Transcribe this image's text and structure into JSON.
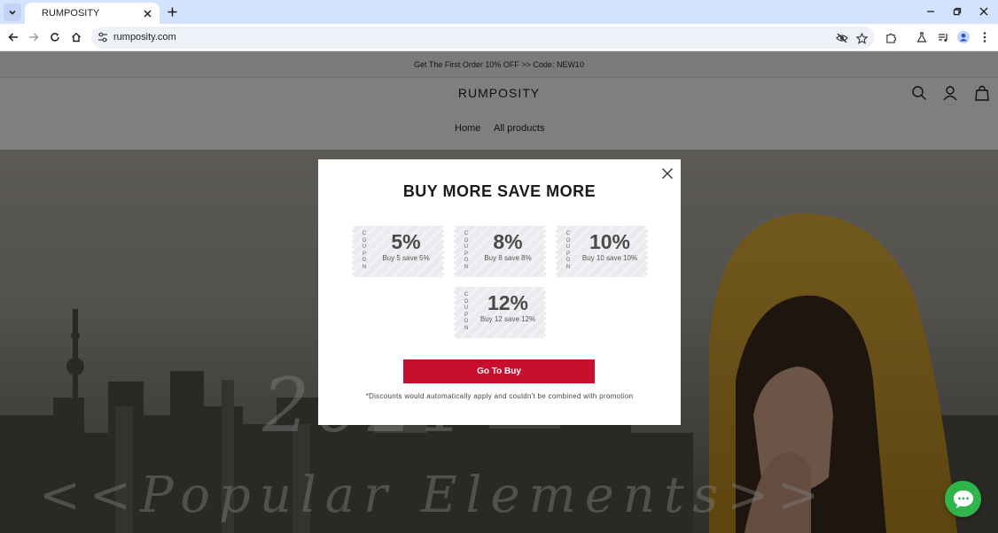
{
  "browser": {
    "tab_title": "RUMPOSITY",
    "url": "rumposity.com"
  },
  "icons": {
    "tab_list": "chevron-down-icon",
    "tab_close": "close-icon",
    "new_tab": "plus-icon",
    "minimize": "minimize-icon",
    "restore": "restore-icon",
    "close_window": "close-icon",
    "back": "arrow-left-icon",
    "forward": "arrow-right-icon",
    "reload": "reload-icon",
    "home": "home-icon",
    "site_info": "tune-icon",
    "eye_off": "eye-off-icon",
    "bookmark": "star-icon",
    "extensions": "puzzle-icon",
    "labs": "flask-icon",
    "media": "media-queue-icon",
    "profile": "person-icon",
    "menu": "more-vertical-icon",
    "search": "search-icon",
    "account": "user-icon",
    "cart": "bag-icon",
    "modal_close": "close-icon",
    "chat": "chat-bubble-icon"
  },
  "colors": {
    "accent_button": "#c8102e",
    "chat_button": "#2fb54b",
    "tabstrip": "#d3e3fd"
  },
  "site": {
    "announcement": "Get The First Order 10% OFF >> Code: NEW10",
    "logo": "RUMPOSITY",
    "nav": {
      "home": "Home",
      "all_products": "All products"
    }
  },
  "hero": {
    "year_text": "2021",
    "tagline": "<<Popular Elements>>"
  },
  "modal": {
    "title": "BUY MORE SAVE MORE",
    "coupon_vertical_label": "COUPON",
    "coupons": [
      {
        "percent": "5%",
        "desc": "Buy 5 save 5%"
      },
      {
        "percent": "8%",
        "desc": "Buy 8 save 8%"
      },
      {
        "percent": "10%",
        "desc": "Buy 10 save 10%"
      },
      {
        "percent": "12%",
        "desc": "Buy 12 save 12%"
      }
    ],
    "button": "Go To Buy",
    "disclaimer": "*Discounts would automatically apply and couldn't be combined with promotion"
  }
}
